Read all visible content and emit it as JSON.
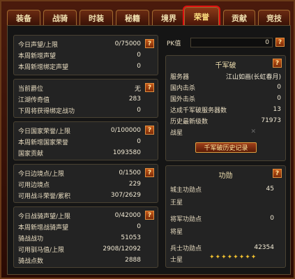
{
  "tabs": [
    "装备",
    "战骑",
    "时装",
    "秘籍",
    "境界",
    "荣誉",
    "贡献",
    "竞技"
  ],
  "active_tab": "荣誉",
  "help_glyph": "?",
  "pk": {
    "label": "PK值",
    "value": "0"
  },
  "qianjun": {
    "title": "千军破",
    "rows": [
      {
        "label": "服务器",
        "value": "江山如画(长虹春月)"
      },
      {
        "label": "国内击杀",
        "value": "0"
      },
      {
        "label": "国外击杀",
        "value": "0"
      },
      {
        "label": "达成千军破服务器数",
        "value": "13"
      },
      {
        "label": "历史最新级数",
        "value": "71973"
      },
      {
        "label": "战星",
        "value": "✕"
      }
    ],
    "button": "千军破历史记录"
  },
  "gongxun": {
    "title": "功勋",
    "rows": [
      {
        "label": "城主功勋点",
        "value": "45"
      },
      {
        "label": "王星",
        "value": ""
      },
      {
        "label": "将军功勋点",
        "value": "0"
      },
      {
        "label": "将星",
        "value": ""
      },
      {
        "label": "兵士功勋点",
        "value": "42354"
      },
      {
        "label": "士星",
        "value": ""
      }
    ],
    "stars": "✦✦✦✦✦✦✦✦"
  },
  "sections": [
    {
      "rows": [
        {
          "label": "今日声望/上限",
          "value": "0/75000"
        },
        {
          "label": "本周新增声望",
          "value": "0"
        },
        {
          "label": "本周新增绑定声望",
          "value": "0"
        }
      ]
    },
    {
      "rows": [
        {
          "label": "当前爵位",
          "value": "无"
        },
        {
          "label": "江湖传奇值",
          "value": "283"
        },
        {
          "label": "下周将获得绑定战功",
          "value": "0"
        }
      ]
    },
    {
      "rows": [
        {
          "label": "今日国家荣誉/上限",
          "value": "0/100000"
        },
        {
          "label": "本周新增国家荣誉",
          "value": "0"
        },
        {
          "label": "国家贡献",
          "value": "1093580"
        }
      ]
    },
    {
      "rows": [
        {
          "label": "今日边境点/上限",
          "value": "0/1500"
        },
        {
          "label": "可用边境点",
          "value": "229"
        },
        {
          "label": "可用战斗荣誉/累积",
          "value": "307/2629"
        }
      ]
    },
    {
      "rows": [
        {
          "label": "今日战骑声望/上限",
          "value": "0/42000"
        },
        {
          "label": "本周新增战骑声望",
          "value": "0"
        },
        {
          "label": "骑战战功",
          "value": "51053"
        },
        {
          "label": "可用驯马值/上限",
          "value": "2908/12092"
        },
        {
          "label": "骑战点数",
          "value": "2888"
        }
      ]
    }
  ]
}
